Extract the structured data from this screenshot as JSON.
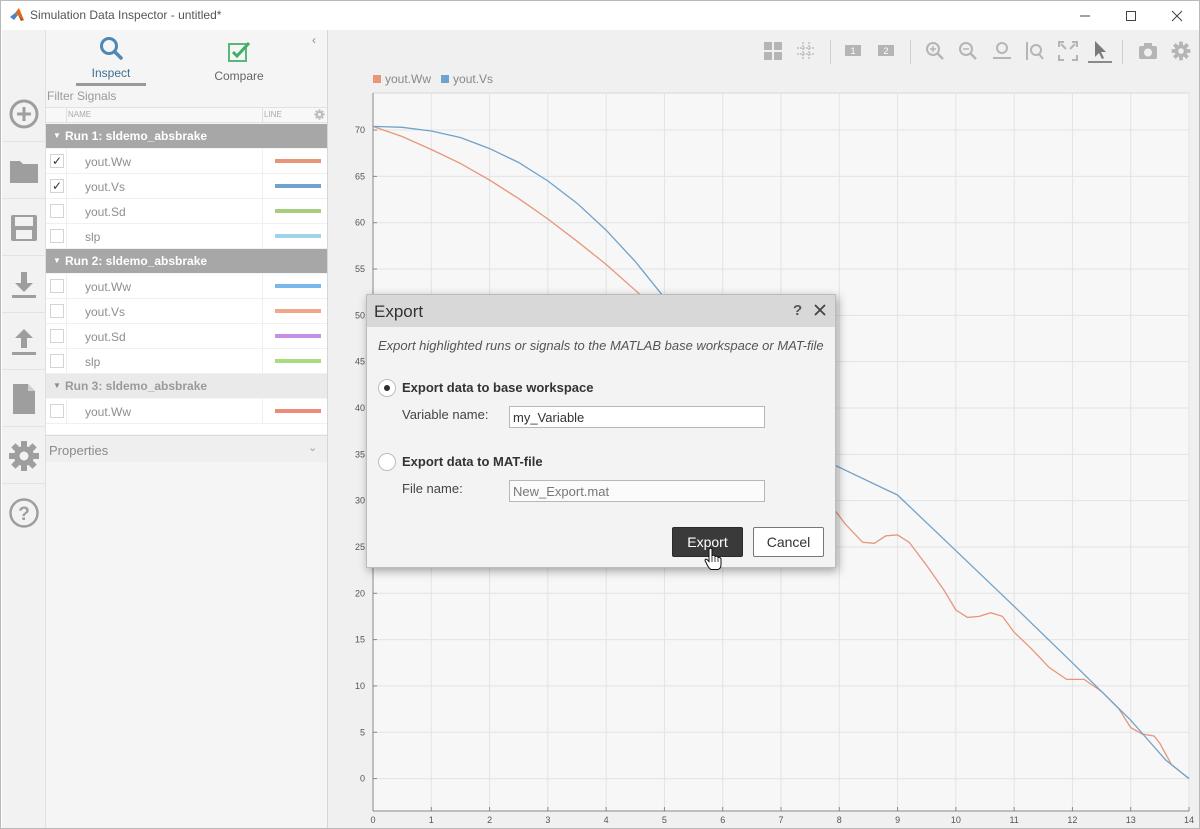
{
  "window": {
    "title": "Simulation Data Inspector - untitled*",
    "app_icon": "matlab-logo",
    "controls": [
      "minimize-icon",
      "maximize-icon",
      "close-icon"
    ]
  },
  "rail": {
    "items": [
      {
        "icon": "add-circle-icon",
        "label": "New"
      },
      {
        "icon": "folder-icon",
        "label": "Open"
      },
      {
        "icon": "save-icon",
        "label": "Save"
      },
      {
        "icon": "import-icon",
        "label": "Import"
      },
      {
        "icon": "export-icon",
        "label": "Export"
      },
      {
        "icon": "report-icon",
        "label": "Report"
      },
      {
        "icon": "gear-icon",
        "label": "Settings"
      },
      {
        "icon": "help-icon",
        "label": "Help"
      }
    ]
  },
  "signals_panel": {
    "tabs": [
      {
        "label": "Inspect",
        "icon": "search-icon",
        "active": true
      },
      {
        "label": "Compare",
        "icon": "checkmark-icon",
        "active": false
      }
    ],
    "filter_placeholder": "Filter Signals",
    "columns": {
      "name": "NAME",
      "line": "LINE"
    },
    "runs": [
      {
        "label": "Run 1: sldemo_absbrake",
        "signals": [
          {
            "name": "yout.Ww",
            "checked": true,
            "color": "#e8967a"
          },
          {
            "name": "yout.Vs",
            "checked": true,
            "color": "#6fa2cc"
          },
          {
            "name": "yout.Sd",
            "checked": false,
            "color": "#a6ce7e"
          },
          {
            "name": "slp",
            "checked": false,
            "color": "#9fd3ea"
          }
        ]
      },
      {
        "label": "Run 2: sldemo_absbrake",
        "signals": [
          {
            "name": "yout.Ww",
            "checked": false,
            "color": "#79b8ea"
          },
          {
            "name": "yout.Vs",
            "checked": false,
            "color": "#f0a886"
          },
          {
            "name": "yout.Sd",
            "checked": false,
            "color": "#c78ee6"
          },
          {
            "name": "slp",
            "checked": false,
            "color": "#a8dc7e"
          }
        ]
      },
      {
        "label": "Run 3: sldemo_absbrake",
        "signals": [
          {
            "name": "yout.Ww",
            "checked": false,
            "color": "#ee8a7a"
          }
        ]
      }
    ],
    "properties_label": "Properties"
  },
  "toolbar": {
    "icons": [
      "layout-icon",
      "grid-icon",
      "subplot-1-icon",
      "subplot-2-icon",
      "zoom-in-icon",
      "zoom-out-icon",
      "zoom-x-icon",
      "zoom-y-icon",
      "fit-view-icon",
      "cursor-icon",
      "snapshot-icon",
      "settings-icon"
    ]
  },
  "chart_data": {
    "type": "line",
    "title": "",
    "xlabel": "",
    "ylabel": "",
    "xlim": [
      0,
      14
    ],
    "ylim": [
      -3.5,
      74
    ],
    "xticks": [
      0,
      1,
      2,
      3,
      4,
      5,
      6,
      7,
      8,
      9,
      10,
      11,
      12,
      13,
      14
    ],
    "yticks": [
      0,
      5,
      10,
      15,
      20,
      25,
      30,
      35,
      40,
      45,
      50,
      55,
      60,
      65,
      70
    ],
    "grid": true,
    "legend": "top-left",
    "series": [
      {
        "name": "yout.Ww",
        "color": "#e8967a",
        "x": [
          0,
          0.5,
          1,
          1.5,
          2,
          2.5,
          3,
          3.5,
          4,
          4.5,
          5,
          5.5,
          6,
          6.5,
          7,
          7.5,
          7.8,
          8.1,
          8.4,
          8.6,
          8.8,
          9,
          9.2,
          9.5,
          9.8,
          10,
          10.2,
          10.4,
          10.6,
          10.8,
          11,
          11.3,
          11.6,
          11.9,
          12.2,
          12.5,
          12.8,
          13,
          13.2,
          13.4,
          13.5,
          13.7,
          14
        ],
        "y": [
          70.4,
          69.3,
          67.9,
          66.4,
          64.6,
          62.6,
          60.4,
          58.0,
          55.5,
          52.7,
          49.8,
          46.7,
          43.5,
          40.1,
          36.6,
          32.6,
          30.0,
          27.5,
          25.5,
          25.4,
          26.2,
          26.3,
          25.5,
          23.0,
          20.3,
          18.2,
          17.4,
          17.5,
          17.9,
          17.5,
          15.8,
          14.0,
          12.0,
          10.7,
          10.7,
          9.4,
          7.5,
          5.5,
          4.8,
          4.6,
          3.8,
          1.5,
          0.0
        ]
      },
      {
        "name": "yout.Vs",
        "color": "#6fa2cc",
        "x": [
          0,
          0.5,
          1,
          1.5,
          2,
          2.5,
          3,
          3.5,
          4,
          4.5,
          5,
          5.5,
          5.8,
          6.2,
          7,
          8,
          9,
          10,
          11,
          12,
          13,
          13.6,
          14
        ],
        "y": [
          70.4,
          70.3,
          69.9,
          69.2,
          68.0,
          66.5,
          64.5,
          62.1,
          59.2,
          55.8,
          51.9,
          47.5,
          44.5,
          40.7,
          36.6,
          33.6,
          30.6,
          24.6,
          18.6,
          12.5,
          6.3,
          2.0,
          0.0
        ]
      }
    ]
  },
  "export_dialog": {
    "title": "Export",
    "help_icon": "help-icon",
    "close_icon": "close-icon",
    "description": "Export highlighted runs or signals to the MATLAB base workspace or MAT-file",
    "option_workspace": {
      "label": "Export data to base workspace",
      "selected": true,
      "field_label": "Variable name:",
      "value": "my_Variable"
    },
    "option_matfile": {
      "label": "Export data to MAT-file",
      "selected": false,
      "field_label": "File name:",
      "value": "New_Export.mat"
    },
    "export_button": "Export",
    "cancel_button": "Cancel"
  }
}
